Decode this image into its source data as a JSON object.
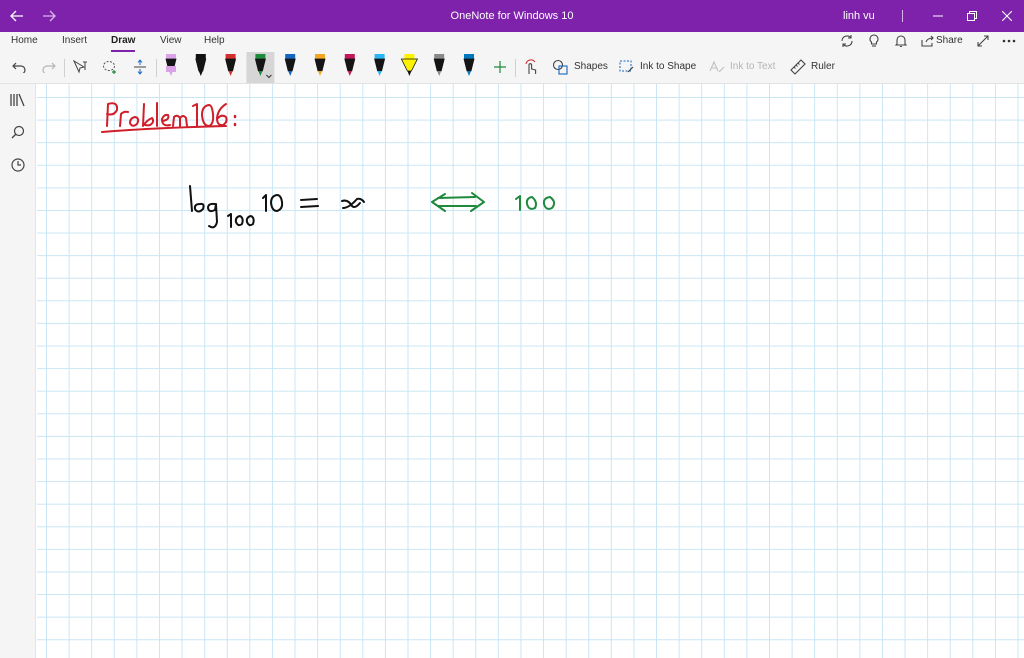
{
  "titlebar": {
    "title": "OneNote for Windows 10",
    "user": "linh vu",
    "back_icon": "back-arrow-icon",
    "forward_icon": "forward-arrow-icon",
    "color": "#7e22ab"
  },
  "tabs": [
    {
      "label": "Home"
    },
    {
      "label": "Insert"
    },
    {
      "label": "Draw",
      "active": true
    },
    {
      "label": "View"
    },
    {
      "label": "Help"
    }
  ],
  "header_actions": {
    "share_label": "Share"
  },
  "toolbar": {
    "shapes_label": "Shapes",
    "ink_to_shape_label": "Ink to Shape",
    "ink_to_text_label": "Ink to Text",
    "ruler_label": "Ruler",
    "pens": [
      {
        "name": "pen-black-pink-highlight",
        "color": "#d9a3e6"
      },
      {
        "name": "pen-black",
        "color": "#111111"
      },
      {
        "name": "pen-red",
        "color": "#d32f2f"
      },
      {
        "name": "pen-green",
        "color": "#1e8a3c",
        "selected": true
      },
      {
        "name": "pen-blue",
        "color": "#1565c0"
      },
      {
        "name": "pen-orange",
        "color": "#f5a623"
      },
      {
        "name": "pen-magenta",
        "color": "#c2185b"
      },
      {
        "name": "pen-cyan",
        "color": "#29b6f6"
      },
      {
        "name": "highlighter-yellow",
        "color": "#fff200"
      },
      {
        "name": "pencil-gray",
        "color": "#8a8a8a"
      },
      {
        "name": "pen-teal",
        "color": "#0277bd"
      }
    ]
  },
  "canvas": {
    "grid_color": "#c9e6f5",
    "ink": [
      {
        "name": "problem-heading-ink",
        "text": "Problem 106 :",
        "color": "#d01e2a"
      },
      {
        "name": "log-equation-ink",
        "text": "log_100 10 = x",
        "color": "#111111"
      },
      {
        "name": "equivalence-arrow-ink",
        "text": "⟺ 100",
        "color": "#1e8a3c"
      }
    ]
  }
}
